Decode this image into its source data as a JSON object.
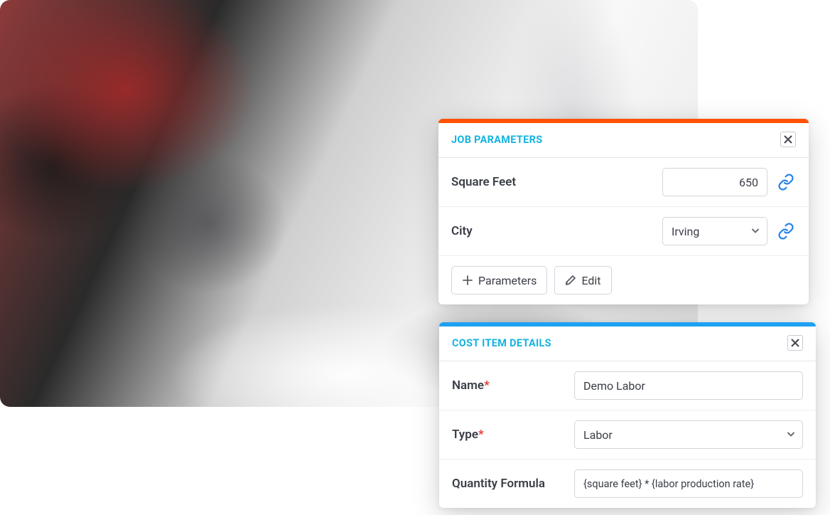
{
  "jobParameters": {
    "title": "JOB PARAMETERS",
    "fields": {
      "squareFeet": {
        "label": "Square Feet",
        "value": "650"
      },
      "city": {
        "label": "City",
        "value": "Irving"
      }
    },
    "buttons": {
      "addParameters": "Parameters",
      "edit": "Edit"
    }
  },
  "costItemDetails": {
    "title": "COST ITEM DETAILS",
    "fields": {
      "name": {
        "label": "Name",
        "required": "*",
        "value": "Demo Labor"
      },
      "type": {
        "label": "Type",
        "required": "*",
        "value": "Labor"
      },
      "quantityFormula": {
        "label": "Quantity Formula",
        "value": "{square feet} * {labor production rate}"
      }
    }
  }
}
